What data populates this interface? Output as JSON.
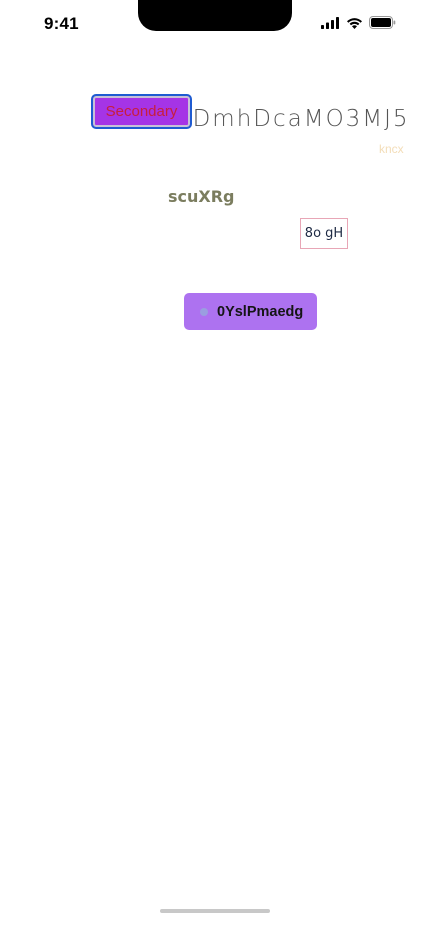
{
  "status_bar": {
    "time": "9:41",
    "icons": [
      "cellular-signal-icon",
      "wifi-icon",
      "battery-icon"
    ]
  },
  "content": {
    "secondary_button_label": "Secondary",
    "long_text": "nDmhDcaMO3MJ5",
    "faint_text": "kncx",
    "olive_text": "scuXRg",
    "boxed_tag": "8o gH",
    "primary_button_label": "0YslPmaedg"
  },
  "colors": {
    "secondary_button_bg": "#a534e6",
    "secondary_button_border": "#1f5bd1",
    "secondary_button_text": "#c81e3d",
    "primary_button_bg": "#ad72f0",
    "olive_text": "#7b7d5f",
    "faint_text": "#f3ddb8",
    "tag_border": "#e8a6b6"
  }
}
